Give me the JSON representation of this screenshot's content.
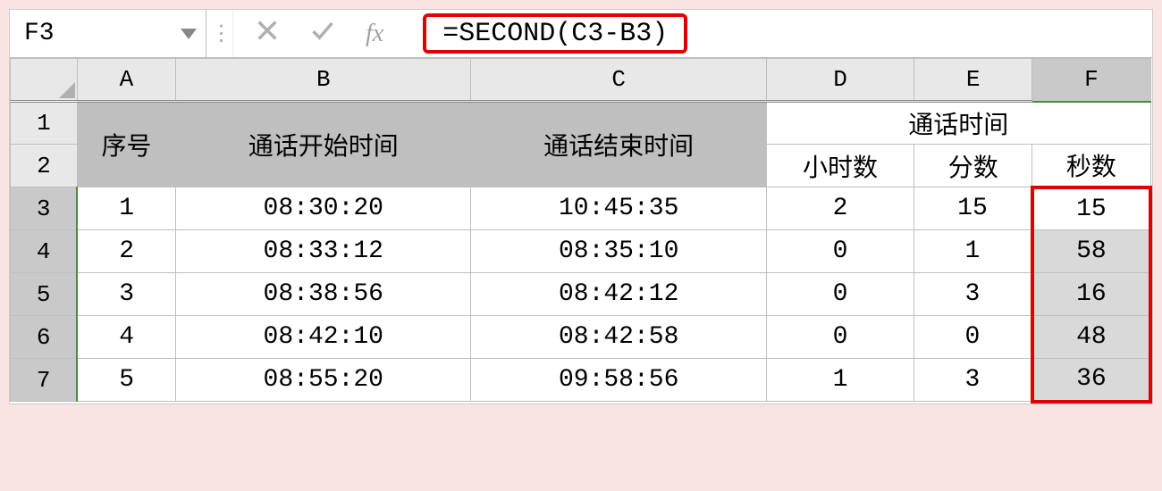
{
  "nameBox": {
    "cellRef": "F3"
  },
  "formulaBar": {
    "cancelIcon": "cancel-icon",
    "confirmIcon": "confirm-icon",
    "fxLabel": "fx",
    "formula": "=SECOND(C3-B3)"
  },
  "columns": {
    "A": "A",
    "B": "B",
    "C": "C",
    "D": "D",
    "E": "E",
    "F": "F"
  },
  "rowNums": {
    "r1": "1",
    "r2": "2",
    "r3": "3",
    "r4": "4",
    "r5": "5",
    "r6": "6",
    "r7": "7"
  },
  "header": {
    "seq": "序号",
    "startTime": "通话开始时间",
    "endTime": "通话结束时间",
    "callDuration": "通话时间",
    "hours": "小时数",
    "minutes": "分数",
    "seconds": "秒数"
  },
  "rows": [
    {
      "seq": "1",
      "start": "08:30:20",
      "end": "10:45:35",
      "h": "2",
      "m": "15",
      "s": "15"
    },
    {
      "seq": "2",
      "start": "08:33:12",
      "end": "08:35:10",
      "h": "0",
      "m": "1",
      "s": "58"
    },
    {
      "seq": "3",
      "start": "08:38:56",
      "end": "08:42:12",
      "h": "0",
      "m": "3",
      "s": "16"
    },
    {
      "seq": "4",
      "start": "08:42:10",
      "end": "08:42:58",
      "h": "0",
      "m": "0",
      "s": "48"
    },
    {
      "seq": "5",
      "start": "08:55:20",
      "end": "09:58:56",
      "h": "1",
      "m": "3",
      "s": "36"
    }
  ],
  "highlight": {
    "column": "F",
    "boxColor": "#e00000",
    "selectionFill": "#d9d9d9"
  }
}
